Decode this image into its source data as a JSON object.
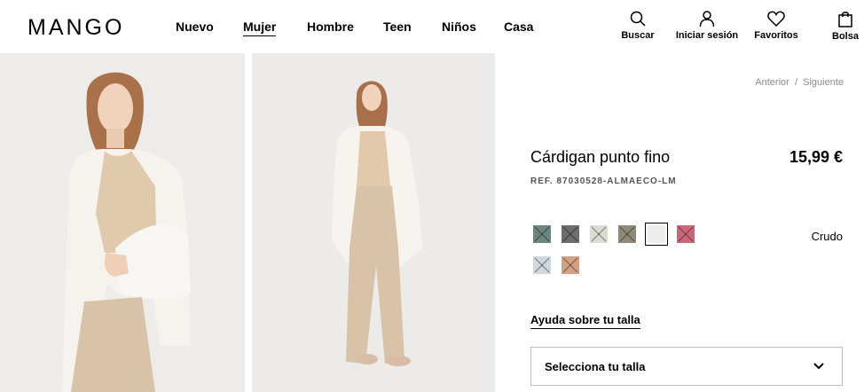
{
  "header": {
    "logo": "MANGO",
    "nav": [
      {
        "label": "Nuevo",
        "active": false
      },
      {
        "label": "Mujer",
        "active": true
      },
      {
        "label": "Hombre",
        "active": false
      },
      {
        "label": "Teen",
        "active": false
      },
      {
        "label": "Niños",
        "active": false
      },
      {
        "label": "Casa",
        "active": false
      }
    ],
    "icons": [
      {
        "icon": "search-icon",
        "label": "Buscar"
      },
      {
        "icon": "user-icon",
        "label": "Iniciar sesión"
      },
      {
        "icon": "heart-icon",
        "label": "Favoritos"
      },
      {
        "icon": "bag-icon",
        "label": "Bolsa"
      }
    ]
  },
  "breadcrumb": {
    "prev": "Anterior",
    "separator": "/",
    "next": "Siguiente"
  },
  "product": {
    "title": "Cárdigan punto fino",
    "price": "15,99 €",
    "ref": "REF. 87030528-ALMAECO-LM",
    "selected_color": "Crudo",
    "swatches": [
      {
        "color": "#6e8682",
        "selected": false
      },
      {
        "color": "#6d6d6f",
        "selected": false
      },
      {
        "color": "#dcdcd4",
        "selected": false
      },
      {
        "color": "#8e8978",
        "selected": false
      },
      {
        "color": "#efede9",
        "selected": true
      },
      {
        "color": "#c86878",
        "selected": false
      },
      {
        "color": "#cfd8dc",
        "selected": false
      },
      {
        "color": "#d3a184",
        "selected": false
      }
    ],
    "size_help": "Ayuda sobre tu talla",
    "size_select_label": "Selecciona tu talla"
  }
}
